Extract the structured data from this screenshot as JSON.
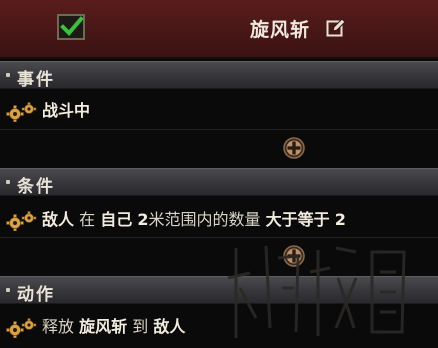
{
  "header": {
    "enabled": true,
    "title": "旋风斩"
  },
  "sections": {
    "event": {
      "label": "事件"
    },
    "condition": {
      "label": "条件"
    },
    "action": {
      "label": "动作"
    }
  },
  "event_row": {
    "text": "战斗中"
  },
  "condition_row": {
    "parts": [
      "敌人",
      "在",
      "自己",
      "2",
      "米范围内的数量",
      "大于等于",
      "2"
    ]
  },
  "action_row": {
    "parts": [
      "释放",
      "旋风斩",
      "到",
      "敌人"
    ]
  },
  "colors": {
    "header_bg": "#4a1818",
    "section_bg": "#3a3a3e",
    "checkmark": "#3fbf3f",
    "gear": "#d8a24a",
    "add_button": "#c7a27a"
  },
  "icons": [
    "checkbox-checked-icon",
    "edit-icon",
    "gears-icon",
    "plus-circle-icon"
  ]
}
